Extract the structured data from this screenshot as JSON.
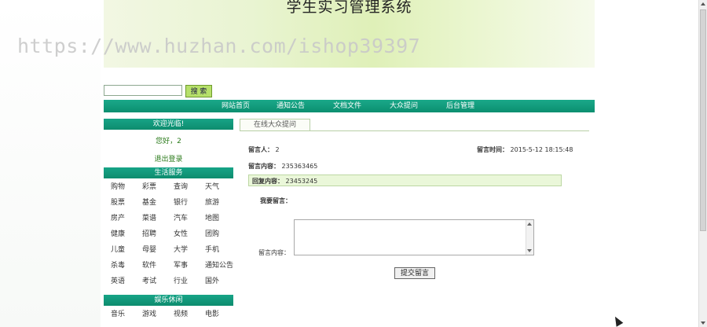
{
  "header": {
    "title": "学生实习管理系统",
    "watermark": "https://www.huzhan.com/ishop39397"
  },
  "search": {
    "value": "",
    "placeholder": "",
    "button": "搜 索"
  },
  "nav": [
    "网站首页",
    "通知公告",
    "文档文件",
    "大众提问",
    "后台管理"
  ],
  "sidebar": {
    "welcome_title": "欢迎光临!",
    "greeting": "您好，2",
    "logout": "退出登录",
    "services_title": "生活服务",
    "services": [
      [
        "购物",
        "彩票",
        "查询",
        "天气"
      ],
      [
        "股票",
        "基金",
        "银行",
        "旅游"
      ],
      [
        "房产",
        "菜谱",
        "汽车",
        "地图"
      ],
      [
        "健康",
        "招聘",
        "女性",
        "团购"
      ],
      [
        "儿童",
        "母婴",
        "大学",
        "手机"
      ],
      [
        "杀毒",
        "软件",
        "军事",
        "通知公告"
      ],
      [
        "英语",
        "考试",
        "行业",
        "国外"
      ]
    ],
    "entertainment_title": "娱乐休闲",
    "entertainment": [
      [
        "音乐",
        "游戏",
        "视频",
        "电影"
      ]
    ]
  },
  "main": {
    "tab": "在线大众提问",
    "author_label": "留言人：",
    "author_value": "2",
    "time_label": "留言时间：",
    "time_value": "2015-5-12 18:15:48",
    "content_label": "留言内容：",
    "content_value": "235363465",
    "reply_label": "回复内容：",
    "reply_value": "23453245",
    "my_message_label": "我要留言：",
    "message_field_label": "留言内容：",
    "message_value": "",
    "submit": "提交留言"
  }
}
